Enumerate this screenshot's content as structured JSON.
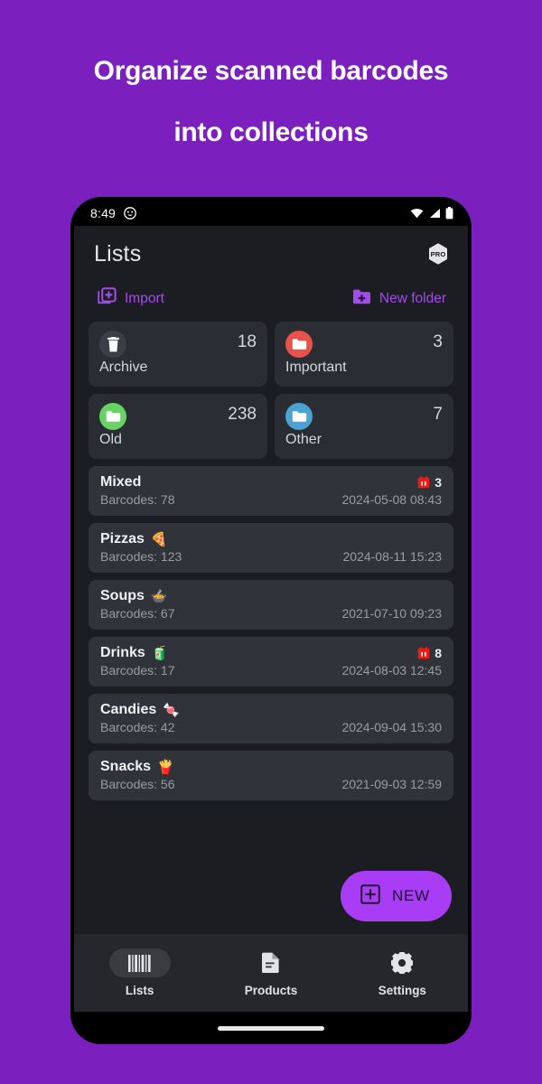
{
  "headline": {
    "line1": "Organize scanned barcodes",
    "line2": "into collections"
  },
  "colors": {
    "background": "#7B1FBF",
    "accent": "#A34BEF",
    "fab": "#A93CF5",
    "screen": "#1C1D22",
    "card": "#2B2D35",
    "row": "#31333B"
  },
  "statusbar": {
    "time": "8:49",
    "emoji": "☺",
    "icons": [
      "wifi-icon",
      "signal-icon",
      "battery-icon"
    ]
  },
  "appbar": {
    "title": "Lists",
    "pro_label": "PRO"
  },
  "actions": [
    {
      "label": "Import",
      "icon": "import-stack-plus-icon"
    },
    {
      "label": "New folder",
      "icon": "folder-plus-icon"
    }
  ],
  "folders": [
    {
      "name": "Archive",
      "count": "18",
      "icon": "trash-icon",
      "color": "#3C3E46"
    },
    {
      "name": "Important",
      "count": "3",
      "icon": "folder-icon",
      "color": "#E8524A"
    },
    {
      "name": "Old",
      "count": "238",
      "icon": "folder-icon",
      "color": "#68D264"
    },
    {
      "name": "Other",
      "count": "7",
      "icon": "folder-icon",
      "color": "#4AA3D0"
    }
  ],
  "lists": [
    {
      "name": "Mixed",
      "emoji": "",
      "subtitle": "Barcodes: 78",
      "date": "2024-05-08 08:43",
      "badge_count": "3"
    },
    {
      "name": "Pizzas",
      "emoji": "🍕",
      "subtitle": "Barcodes: 123",
      "date": "2024-08-11 15:23",
      "badge_count": ""
    },
    {
      "name": "Soups",
      "emoji": "🍲",
      "subtitle": "Barcodes: 67",
      "date": "2021-07-10 09:23",
      "badge_count": ""
    },
    {
      "name": "Drinks",
      "emoji": "🧃",
      "subtitle": "Barcodes: 17",
      "date": "2024-08-03 12:45",
      "badge_count": "8"
    },
    {
      "name": "Candies",
      "emoji": "🍬",
      "subtitle": "Barcodes: 42",
      "date": "2024-09-04 15:30",
      "badge_count": ""
    },
    {
      "name": "Snacks",
      "emoji": "🍟",
      "subtitle": "Barcodes: 56",
      "date": "2021-09-03 12:59",
      "badge_count": ""
    }
  ],
  "fab": {
    "label": "NEW",
    "icon": "box-plus-icon"
  },
  "bottomnav": [
    {
      "label": "Lists",
      "icon": "barcode-icon",
      "active": true
    },
    {
      "label": "Products",
      "icon": "document-icon",
      "active": false
    },
    {
      "label": "Settings",
      "icon": "gear-icon",
      "active": false
    }
  ]
}
